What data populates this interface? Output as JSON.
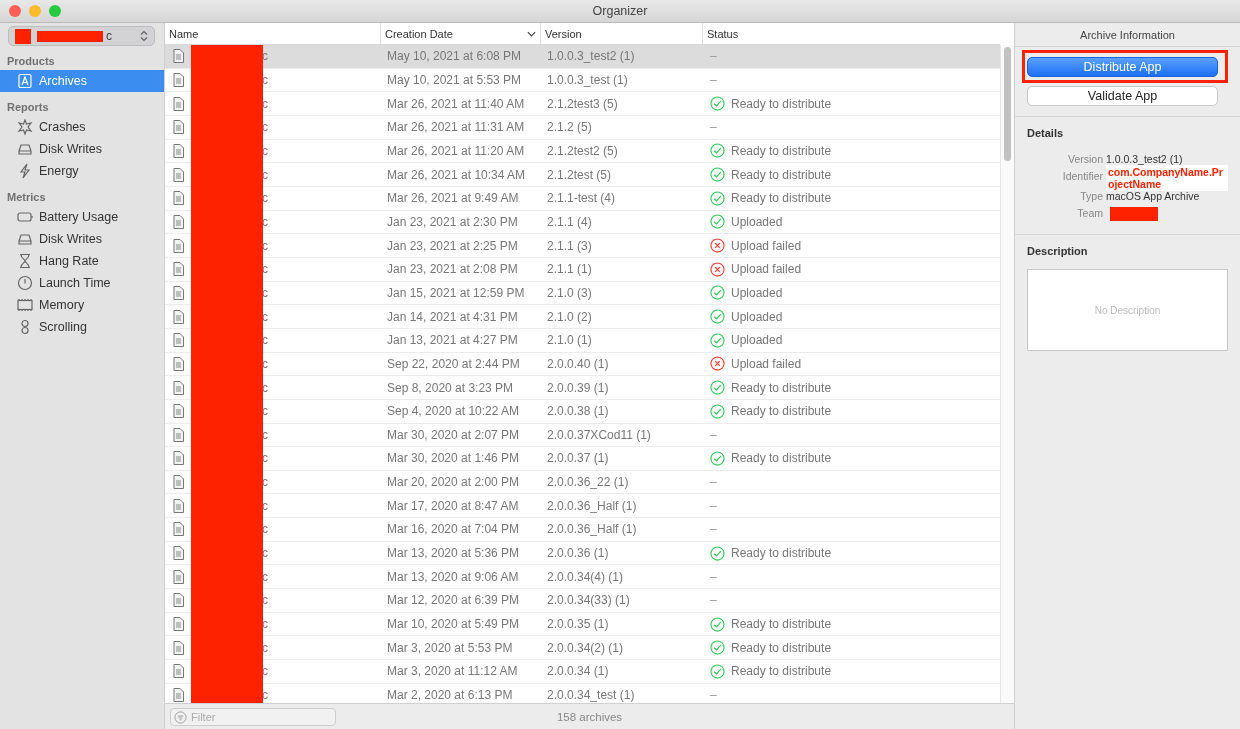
{
  "window": {
    "title": "Organizer"
  },
  "project_selector": {
    "value": "c"
  },
  "sidebar": {
    "sections": [
      {
        "title": "Products",
        "items": [
          {
            "label": "Archives",
            "kind": "archive",
            "selected": true
          }
        ]
      },
      {
        "title": "Reports",
        "items": [
          {
            "label": "Crashes",
            "kind": "crash",
            "selected": false
          },
          {
            "label": "Disk Writes",
            "kind": "disk",
            "selected": false
          },
          {
            "label": "Energy",
            "kind": "energy",
            "selected": false
          }
        ]
      },
      {
        "title": "Metrics",
        "items": [
          {
            "label": "Battery Usage",
            "kind": "battery",
            "selected": false
          },
          {
            "label": "Disk Writes",
            "kind": "disk",
            "selected": false
          },
          {
            "label": "Hang Rate",
            "kind": "hourglass",
            "selected": false
          },
          {
            "label": "Launch Time",
            "kind": "clock",
            "selected": false
          },
          {
            "label": "Memory",
            "kind": "memory",
            "selected": false
          },
          {
            "label": "Scrolling",
            "kind": "scroll",
            "selected": false
          }
        ]
      }
    ]
  },
  "table": {
    "columns": [
      {
        "label": "Name",
        "sorted": false
      },
      {
        "label": "Creation Date",
        "sorted": true
      },
      {
        "label": "Version",
        "sorted": false
      },
      {
        "label": "Status",
        "sorted": false
      }
    ],
    "rows": [
      {
        "name": "c",
        "date": "May 10, 2021 at 6:08 PM",
        "version": "1.0.0.3_test2 (1)",
        "status": "–",
        "kind": "none",
        "selected": true
      },
      {
        "name": "c",
        "date": "May 10, 2021 at 5:53 PM",
        "version": "1.0.0.3_test (1)",
        "status": "–",
        "kind": "none",
        "selected": false
      },
      {
        "name": "c",
        "date": "Mar 26, 2021 at 11:40 AM",
        "version": "2.1.2test3 (5)",
        "status": "Ready to distribute",
        "kind": "ok",
        "selected": false
      },
      {
        "name": "c",
        "date": "Mar 26, 2021 at 11:31 AM",
        "version": "2.1.2 (5)",
        "status": "–",
        "kind": "none",
        "selected": false
      },
      {
        "name": "c",
        "date": "Mar 26, 2021 at 11:20 AM",
        "version": "2.1.2test2 (5)",
        "status": "Ready to distribute",
        "kind": "ok",
        "selected": false
      },
      {
        "name": "c",
        "date": "Mar 26, 2021 at 10:34 AM",
        "version": "2.1.2test (5)",
        "status": "Ready to distribute",
        "kind": "ok",
        "selected": false
      },
      {
        "name": "c",
        "date": "Mar 26, 2021 at 9:49 AM",
        "version": "2.1.1-test (4)",
        "status": "Ready to distribute",
        "kind": "ok",
        "selected": false
      },
      {
        "name": "c",
        "date": "Jan 23, 2021 at 2:30 PM",
        "version": "2.1.1 (4)",
        "status": "Uploaded",
        "kind": "ok",
        "selected": false
      },
      {
        "name": "c",
        "date": "Jan 23, 2021 at 2:25 PM",
        "version": "2.1.1 (3)",
        "status": "Upload failed",
        "kind": "failed",
        "selected": false
      },
      {
        "name": "c",
        "date": "Jan 23, 2021 at 2:08 PM",
        "version": "2.1.1 (1)",
        "status": "Upload failed",
        "kind": "failed",
        "selected": false
      },
      {
        "name": "c",
        "date": "Jan 15, 2021 at 12:59 PM",
        "version": "2.1.0 (3)",
        "status": "Uploaded",
        "kind": "ok",
        "selected": false
      },
      {
        "name": "c",
        "date": "Jan 14, 2021 at 4:31 PM",
        "version": "2.1.0 (2)",
        "status": "Uploaded",
        "kind": "ok",
        "selected": false
      },
      {
        "name": "c",
        "date": "Jan 13, 2021 at 4:27 PM",
        "version": "2.1.0 (1)",
        "status": "Uploaded",
        "kind": "ok",
        "selected": false
      },
      {
        "name": "c",
        "date": "Sep 22, 2020 at 2:44 PM",
        "version": "2.0.0.40 (1)",
        "status": "Upload failed",
        "kind": "failed",
        "selected": false
      },
      {
        "name": "c",
        "date": "Sep 8, 2020 at 3:23 PM",
        "version": "2.0.0.39 (1)",
        "status": "Ready to distribute",
        "kind": "ok",
        "selected": false
      },
      {
        "name": "c",
        "date": "Sep 4, 2020 at 10:22 AM",
        "version": "2.0.0.38 (1)",
        "status": "Ready to distribute",
        "kind": "ok",
        "selected": false
      },
      {
        "name": "c",
        "date": "Mar 30, 2020 at 2:07 PM",
        "version": "2.0.0.37XCod11 (1)",
        "status": "–",
        "kind": "none",
        "selected": false
      },
      {
        "name": "c",
        "date": "Mar 30, 2020 at 1:46 PM",
        "version": "2.0.0.37 (1)",
        "status": "Ready to distribute",
        "kind": "ok",
        "selected": false
      },
      {
        "name": "c",
        "date": "Mar 20, 2020 at 2:00 PM",
        "version": "2.0.0.36_22 (1)",
        "status": "–",
        "kind": "none",
        "selected": false
      },
      {
        "name": "c",
        "date": "Mar 17, 2020 at 8:47 AM",
        "version": "2.0.0.36_Half (1)",
        "status": "–",
        "kind": "none",
        "selected": false
      },
      {
        "name": "c",
        "date": "Mar 16, 2020 at 7:04 PM",
        "version": "2.0.0.36_Half (1)",
        "status": "–",
        "kind": "none",
        "selected": false
      },
      {
        "name": "c",
        "date": "Mar 13, 2020 at 5:36 PM",
        "version": "2.0.0.36 (1)",
        "status": "Ready to distribute",
        "kind": "ok",
        "selected": false
      },
      {
        "name": "c",
        "date": "Mar 13, 2020 at 9:06 AM",
        "version": "2.0.0.34(4) (1)",
        "status": "–",
        "kind": "none",
        "selected": false
      },
      {
        "name": "c",
        "date": "Mar 12, 2020 at 6:39 PM",
        "version": "2.0.0.34(33) (1)",
        "status": "–",
        "kind": "none",
        "selected": false
      },
      {
        "name": "c",
        "date": "Mar 10, 2020 at 5:49 PM",
        "version": "2.0.0.35 (1)",
        "status": "Ready to distribute",
        "kind": "ok",
        "selected": false
      },
      {
        "name": "c",
        "date": "Mar 3, 2020 at 5:53 PM",
        "version": "2.0.0.34(2) (1)",
        "status": "Ready to distribute",
        "kind": "ok",
        "selected": false
      },
      {
        "name": "c",
        "date": "Mar 3, 2020 at 11:12 AM",
        "version": "2.0.0.34 (1)",
        "status": "Ready to distribute",
        "kind": "ok",
        "selected": false
      },
      {
        "name": "c",
        "date": "Mar 2, 2020 at 6:13 PM",
        "version": "2.0.0.34_test (1)",
        "status": "–",
        "kind": "none",
        "selected": false
      }
    ]
  },
  "filter": {
    "placeholder": "Filter"
  },
  "status_bar": {
    "count": "158 archives"
  },
  "inspector": {
    "title": "Archive Information",
    "primary_button": "Distribute App",
    "secondary_button": "Validate App",
    "details_title": "Details",
    "details": [
      {
        "label": "Version",
        "value": "1.0.0.3_test2 (1)",
        "kind": "plain"
      },
      {
        "label": "Identifier",
        "value": "com.CompanyName.ProjectName",
        "kind": "annotated"
      },
      {
        "label": "Type",
        "value": "macOS App Archive",
        "kind": "plain"
      },
      {
        "label": "Team",
        "kind": "redacted"
      }
    ],
    "description_title": "Description",
    "description_placeholder": "No Description"
  }
}
